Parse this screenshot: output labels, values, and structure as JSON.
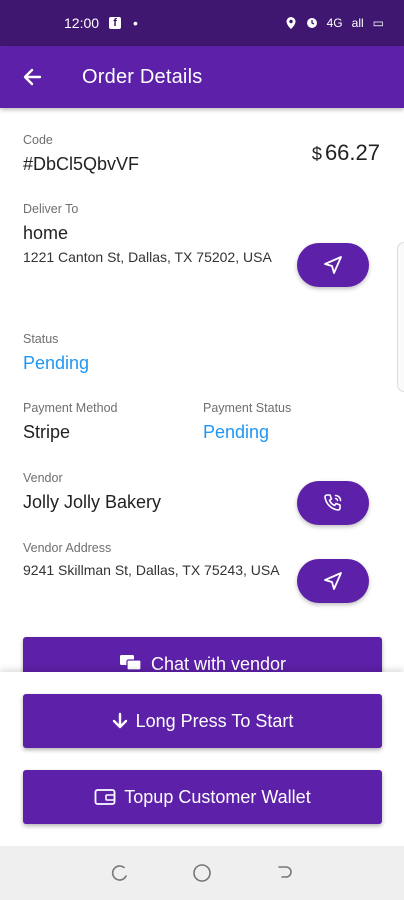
{
  "status_bar": {
    "time": "12:00",
    "facebook_glyph": "f",
    "dot": "•",
    "network": "4G",
    "signal": "all",
    "battery": "▭"
  },
  "app_bar": {
    "title": "Order Details"
  },
  "order": {
    "code_label": "Code",
    "code_value": "#DbCl5QbvVF",
    "currency_symbol": "$",
    "amount": "66.27",
    "deliver_to_label": "Deliver To",
    "deliver_to_name": "home",
    "deliver_to_address": "1221 Canton St, Dallas, TX 75202, USA",
    "status_label": "Status",
    "status_value": "Pending",
    "payment_method_label": "Payment Method",
    "payment_method_value": "Stripe",
    "payment_status_label": "Payment Status",
    "payment_status_value": "Pending",
    "vendor_label": "Vendor",
    "vendor_name": "Jolly Jolly Bakery",
    "vendor_address_label": "Vendor Address",
    "vendor_address": "9241 Skillman St, Dallas, TX 75243, USA"
  },
  "actions": {
    "chat_vendor": "Chat with vendor",
    "long_press": "Long Press To Start",
    "topup_wallet": "Topup Customer Wallet"
  },
  "colors": {
    "status_bar": "#3f1771",
    "primary": "#5d20a8",
    "link_blue": "#2196f3"
  },
  "icons": {
    "back": "arrow-left-icon",
    "navigate": "navigation-arrow-icon",
    "phone": "phone-call-icon",
    "chat": "chat-bubbles-icon",
    "arrow_down": "arrow-down-icon",
    "wallet": "wallet-icon"
  }
}
